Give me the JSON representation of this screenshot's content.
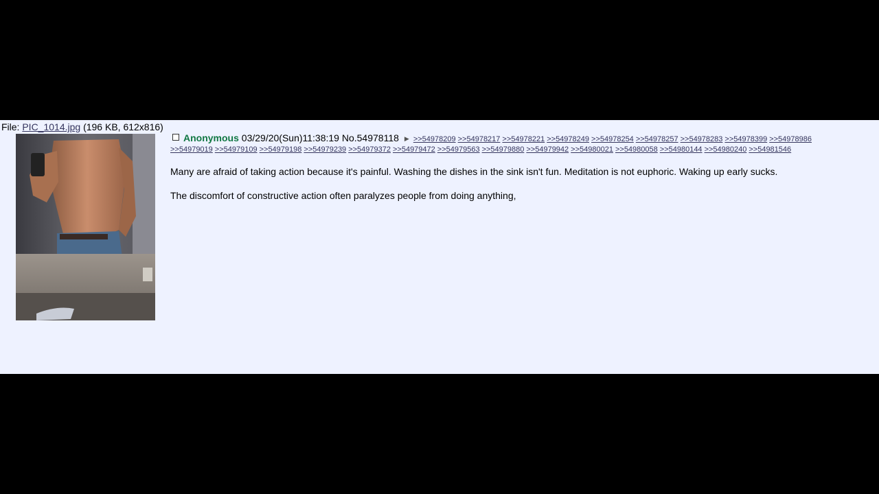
{
  "file": {
    "prefix": "File: ",
    "name": "PIC_1014.jpg",
    "details": " (196 KB, 612x816)"
  },
  "post": {
    "name": "Anonymous",
    "datetime": "03/29/20(Sun)11:38:19",
    "number": "No.54978118",
    "arrow": "▶",
    "backlinks_row1": [
      ">>54978209",
      ">>54978217",
      ">>54978221",
      ">>54978249",
      ">>54978254",
      ">>54978257",
      ">>54978283",
      ">>54978399",
      ">>54978986"
    ],
    "backlinks_row2": [
      ">>54979019",
      ">>54979109",
      ">>54979198",
      ">>54979239",
      ">>54979372",
      ">>54979472",
      ">>54979563",
      ">>54979880",
      ">>54979942",
      ">>54980021",
      ">>54980058",
      ">>54980144",
      ">>54980240",
      ">>54981546"
    ],
    "paragraphs": [
      "Many are afraid of taking action because it's painful. Washing the dishes in the sink isn't fun. Meditation is not euphoric. Waking up early sucks.",
      "The discomfort of constructive action often paralyzes people from doing anything,"
    ]
  },
  "colors": {
    "background": "#000000",
    "panel": "#eef2ff",
    "name": "#117743",
    "link": "#34345c"
  }
}
